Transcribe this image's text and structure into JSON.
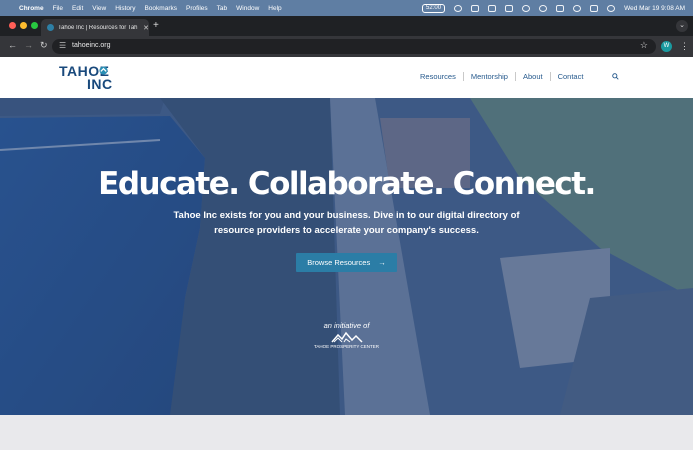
{
  "menubar": {
    "app_name": "Chrome",
    "menus": [
      "File",
      "Edit",
      "View",
      "History",
      "Bookmarks",
      "Profiles",
      "Tab",
      "Window",
      "Help"
    ],
    "battery_time": "52:00",
    "datetime": "Wed Mar 19  9:08 AM"
  },
  "browser": {
    "tab_title": "Tahoe Inc | Resources for Tah",
    "new_tab_label": "+",
    "url": "tahoeinc.org",
    "profile_initial": "W"
  },
  "site": {
    "logo_line1": "TAHOE",
    "logo_line2": "INC",
    "nav": [
      "Resources",
      "Mentorship",
      "About",
      "Contact"
    ]
  },
  "hero": {
    "title": "Educate. Collaborate. Connect.",
    "subtitle": "Tahoe Inc exists for you and your business. Dive in to our digital directory of resource providers to accelerate your company's success.",
    "button_label": "Browse Resources",
    "button_arrow": "→",
    "initiative_label": "an initiative of",
    "partner_name": "TAHOE PROSPERITY CENTER"
  },
  "colors": {
    "menubar": "#5f7ea3",
    "brand_navy": "#19497c",
    "nav_link": "#275a8d",
    "button": "#2b7da6",
    "hero_overlay": "#3f5a86"
  }
}
